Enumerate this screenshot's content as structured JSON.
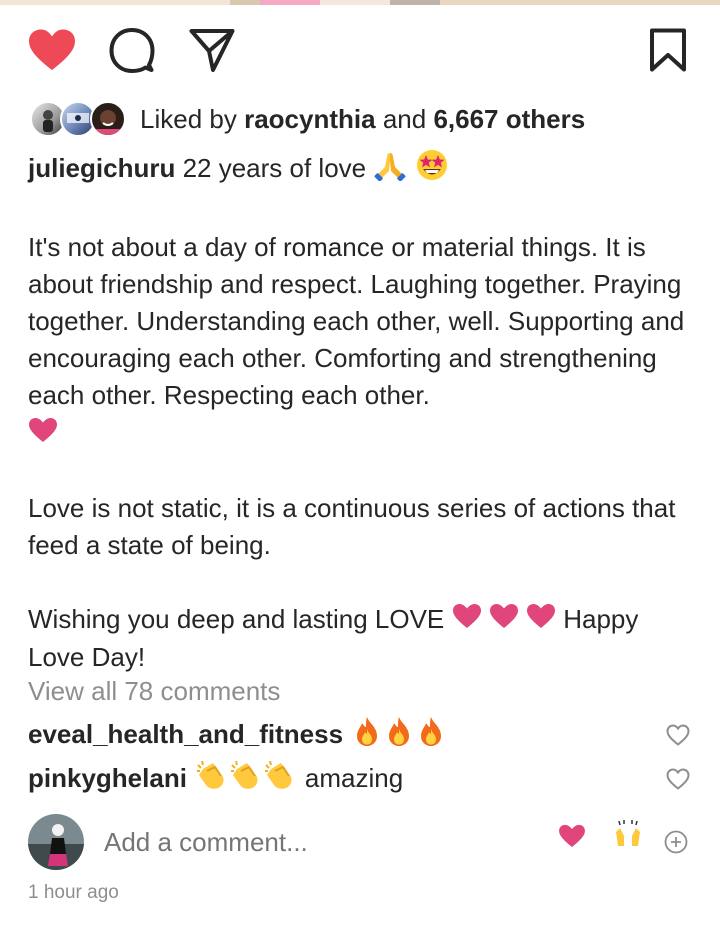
{
  "post": {
    "liked_by_prefix": "Liked by",
    "liked_by_user": "raocynthia",
    "liked_by_and": "and",
    "liked_by_others": "6,667 others",
    "author": "juliegichuru",
    "caption_line1": "22 years of love",
    "paragraph1": "It's not about a day of romance or material things. It is about friendship and respect. Laughing together. Praying together. Understanding each other, well. Supporting and encouraging each other. Comforting and strengthening each other. Respecting each other.",
    "paragraph2": "Love is not static, it is a continuous series of actions that feed a state of being.",
    "paragraph3_a": "Wishing you deep and lasting LOVE",
    "paragraph3_b": "Happy Love Day!",
    "view_all": "View all 78 comments",
    "time_ago": "1 hour ago"
  },
  "comments": [
    {
      "user": "eveal_health_and_fitness",
      "text": ""
    },
    {
      "user": "pinkyghelani",
      "text": "amazing"
    }
  ],
  "add_comment": {
    "placeholder": "Add a comment..."
  },
  "icons": {
    "like": "heart-filled-icon",
    "comment": "comment-bubble-icon",
    "share": "paper-plane-icon",
    "save": "bookmark-icon"
  },
  "colors": {
    "like_red": "#ed4956",
    "pink_heart": "#e0457b",
    "muted": "#8e8e8e",
    "text": "#262626"
  }
}
